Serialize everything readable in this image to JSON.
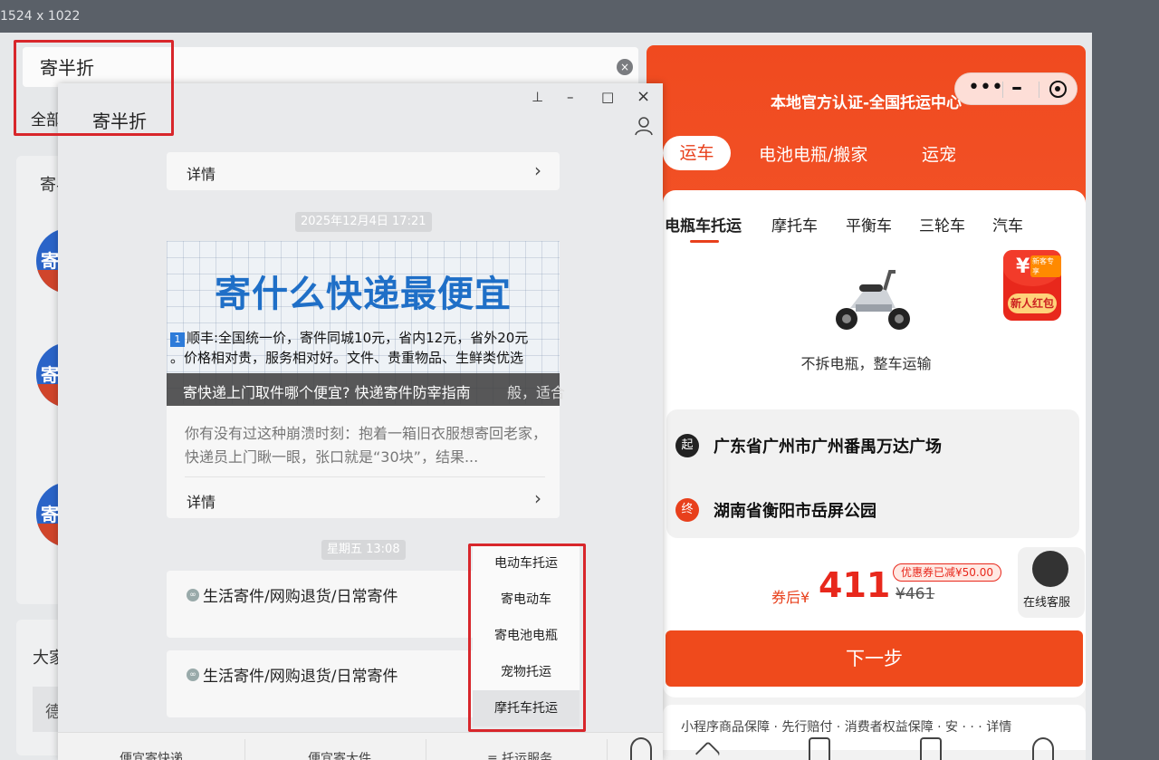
{
  "screen_size_label": "1524 x 1022",
  "search_window": {
    "query": "寄半折",
    "tab_all": "全部",
    "section_title": "寄半",
    "avatar_glyph": "寄",
    "group_title": "大家",
    "input_glyph": "德"
  },
  "chat_window": {
    "title": "寄半折",
    "controls": {
      "pin": "⊥",
      "minimize": "–",
      "maximize": "□",
      "close": "×"
    },
    "detail_label": "详情",
    "timestamp1": "2025年12月4日 17:21",
    "article": {
      "headline": "寄什么快递最便宜",
      "num_badge": "1",
      "body_line1": "顺丰:全国统一价，寄件同城10元，省内12元，省外20元",
      "body_line2": "。价格相对贵，服务相对好。文件、贵重物品、生鲜类优选",
      "overlay_title": "寄快递上门取件哪个便宜? 快递寄件防宰指南",
      "overlay_tail": "般，适合",
      "summary": "你有没有过这种崩溃时刻：抱着一箱旧衣服想寄回老家，快递员上门瞅一眼，张口就是“30块”，结果..."
    },
    "timestamp2": "星期五 13:08",
    "link_messages": [
      "生活寄件/网购退货/日常寄件",
      "生活寄件/网购退货/日常寄件"
    ],
    "menu_items": [
      "电动车托运",
      "寄电动车",
      "寄电池电瓶",
      "宠物托运",
      "摩托车托运"
    ],
    "bottom_menu": [
      "便宜寄快递",
      "便宜寄大件",
      "≡ 托运服务"
    ]
  },
  "mini_program": {
    "title": "本地官方认证-全国托运中心",
    "top_tabs": [
      "运车",
      "电池电瓶/搬家",
      "运宠"
    ],
    "sub_tabs": [
      "电瓶车托运",
      "摩托车",
      "平衡车",
      "三轮车",
      "汽车"
    ],
    "caption": "不拆电瓶，整车运输",
    "hongbao": {
      "yen": "¥",
      "tag": "新客专享",
      "button": "新人红包"
    },
    "from_badge": "起",
    "from_address": "广东省广州市广州番禺万达广场",
    "to_badge": "终",
    "to_address": "湖南省衡阳市岳屏公园",
    "price_label": "券后¥",
    "price": "411",
    "coupon": "优惠券已减¥50.00",
    "original_price": "¥461",
    "next_button": "下一步",
    "bottom_notice": "小程序商品保障 · 先行赔付 · 消费者权益保障 · 安 · · · 详情",
    "service_label": "在线客服",
    "accent_color": "#f04a1f"
  }
}
